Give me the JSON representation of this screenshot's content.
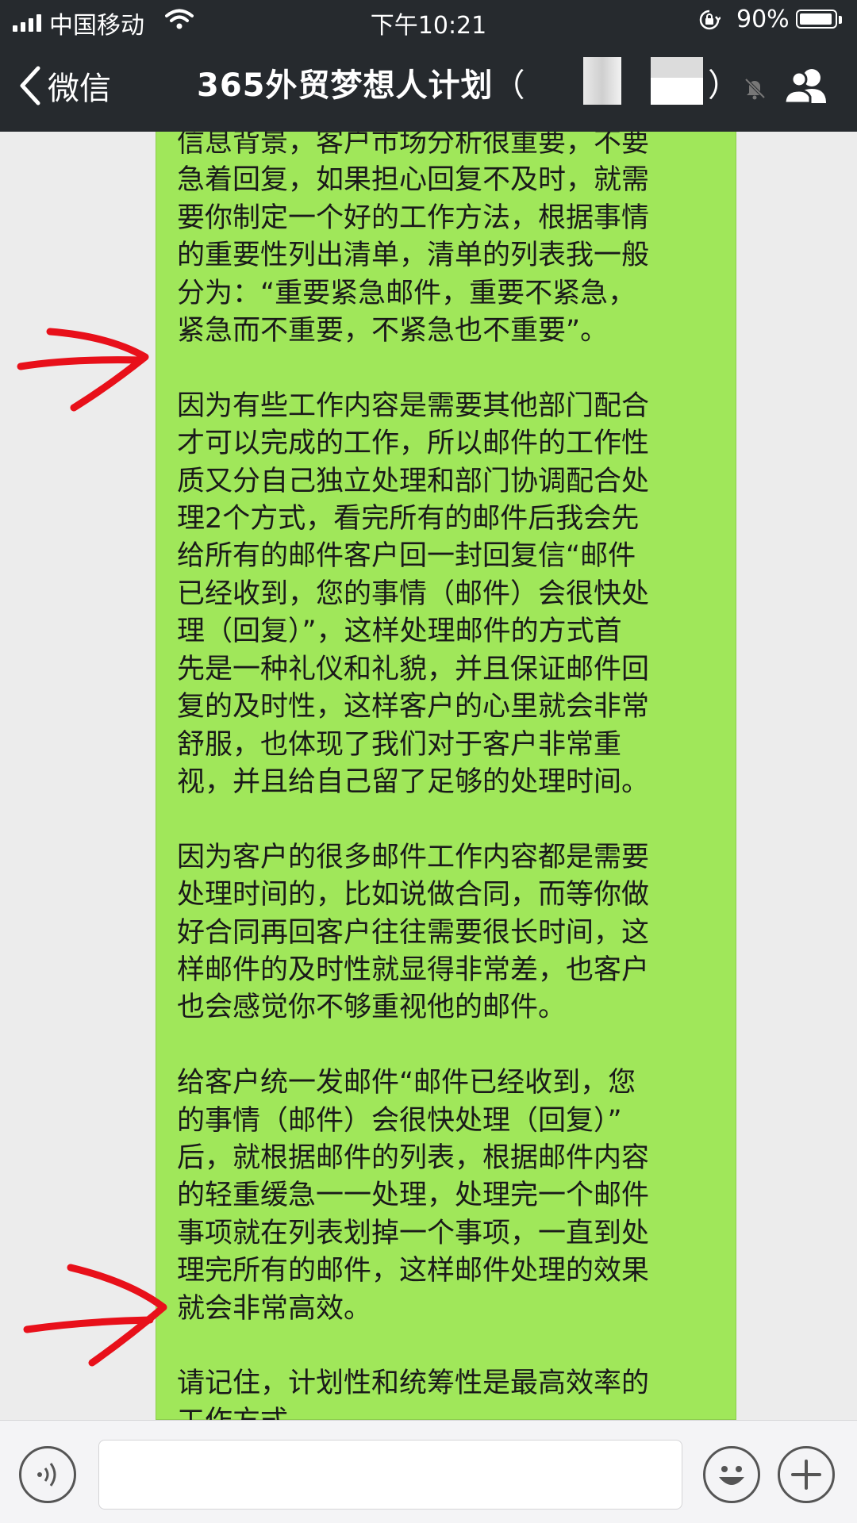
{
  "status_bar": {
    "carrier": "中国移动",
    "time": "下午10:21",
    "battery": "90%",
    "battery_level": 0.9
  },
  "nav": {
    "back_label": "微信",
    "title": "365外贸梦想人计划",
    "title_paren_open": "（",
    "title_paren_close": "）"
  },
  "message": {
    "text": "信息背景，客户市场分析很重要，不要\n急着回复，如果担心回复不及时，就需\n要你制定一个好的工作方法，根据事情\n的重要性列出清单，清单的列表我一般\n分为：“重要紧急邮件，重要不紧急，\n紧急而不重要，不紧急也不重要”。\n\n因为有些工作内容是需要其他部门配合\n才可以完成的工作，所以邮件的工作性\n质又分自己独立处理和部门协调配合处\n理2个方式，看完所有的邮件后我会先\n给所有的邮件客户回一封回复信“邮件\n已经收到，您的事情（邮件）会很快处\n理（回复）”，这样处理邮件的方式首\n先是一种礼仪和礼貌，并且保证邮件回\n复的及时性，这样客户的心里就会非常\n舒服，也体现了我们对于客户非常重\n视，并且给自己留了足够的处理时间。\n\n因为客户的很多邮件工作内容都是需要\n处理时间的，比如说做合同，而等你做\n好合同再回客户往往需要很长时间，这\n样邮件的及时性就显得非常差，也客户\n也会感觉你不够重视他的邮件。\n\n给客户统一发邮件“邮件已经收到，您\n的事情（邮件）会很快处理（回复）”\n后，就根据邮件的列表，根据邮件内容\n的轻重缓急一一处理，处理完一个邮件\n事项就在列表划掉一个事项，一直到处\n理完所有的邮件，这样邮件处理的效果\n就会非常高效。\n\n请记住，计划性和统筹性是最高效率的\n工作方式。"
  },
  "input": {
    "value": ""
  },
  "colors": {
    "nav_background": "#262a2e",
    "bubble": "#a0e75a",
    "chat_background": "#ececec",
    "annotation_arrow": "#e8101a"
  },
  "icons": [
    "signal-icon",
    "wifi-icon",
    "orientation-lock-icon",
    "battery-icon",
    "back-chevron-icon",
    "mute-icon",
    "group-members-icon",
    "voice-icon",
    "emoji-icon",
    "plus-icon"
  ]
}
